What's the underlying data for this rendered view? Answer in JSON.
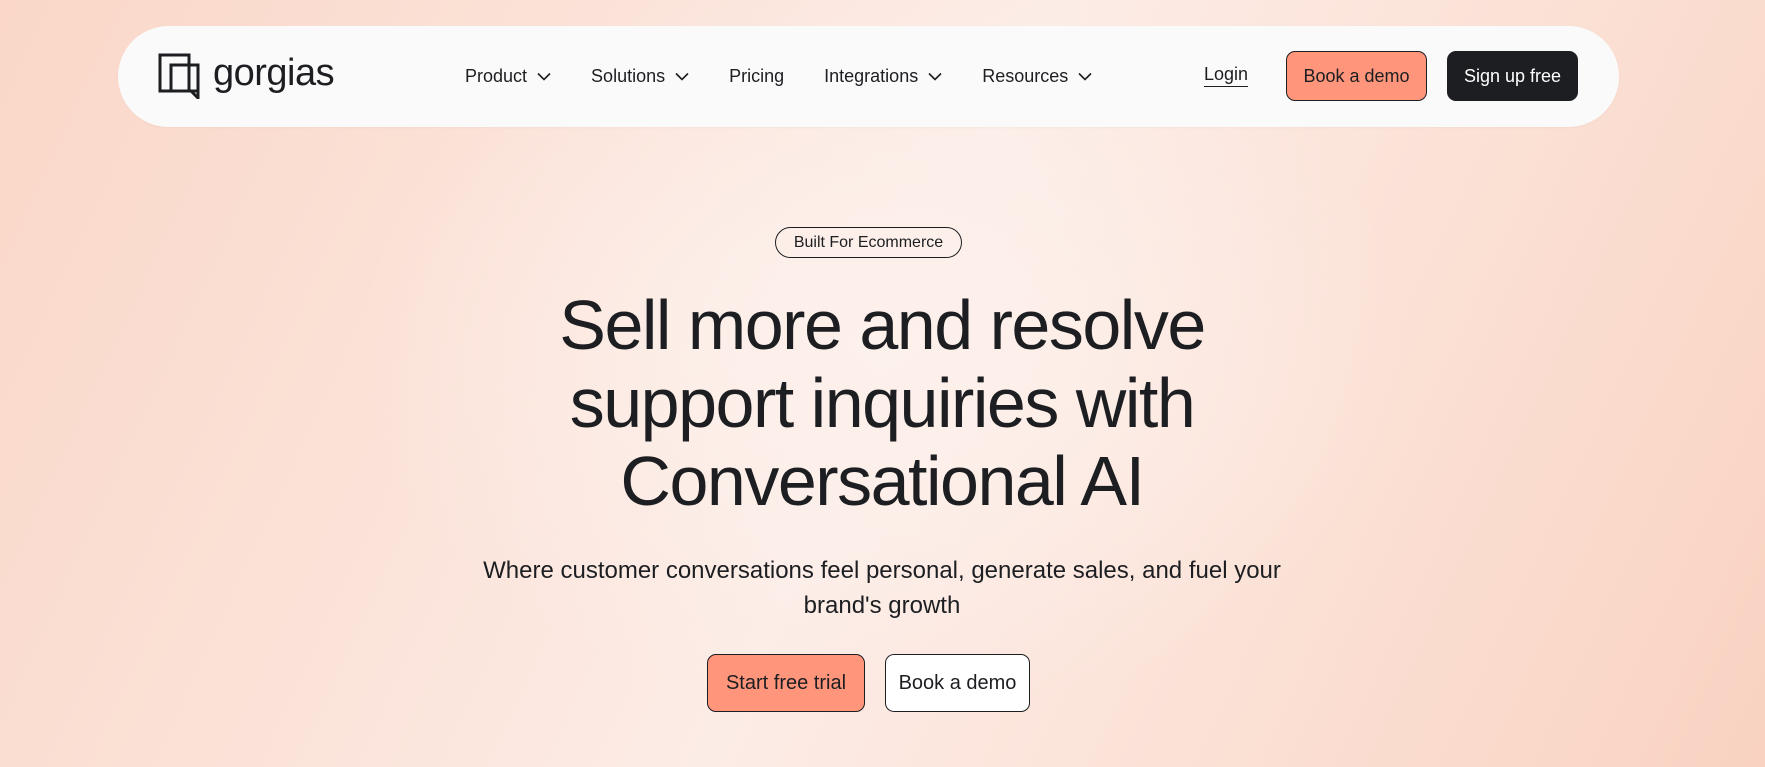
{
  "brand": {
    "name": "gorgias",
    "logo_icon": "gorgias-logo-mark",
    "primary_color": "#ff967c",
    "dark_color": "#1c1e21"
  },
  "nav": {
    "items": [
      {
        "label": "Product",
        "has_dropdown": true,
        "icon": "chevron-down-icon"
      },
      {
        "label": "Solutions",
        "has_dropdown": true,
        "icon": "chevron-down-icon"
      },
      {
        "label": "Pricing",
        "has_dropdown": false
      },
      {
        "label": "Integrations",
        "has_dropdown": true,
        "icon": "chevron-down-icon"
      },
      {
        "label": "Resources",
        "has_dropdown": true,
        "icon": "chevron-down-icon"
      }
    ],
    "login_label": "Login",
    "book_demo_label": "Book a demo",
    "signup_label": "Sign up free"
  },
  "hero": {
    "badge": "Built For Ecommerce",
    "title_lines": [
      "Sell more and resolve",
      "support inquiries with",
      "Conversational AI"
    ],
    "subtitle_lines": [
      "Where customer conversations feel personal, generate sales, and fuel your",
      "brand's growth"
    ],
    "primary_cta": "Start free trial",
    "secondary_cta": "Book a demo"
  }
}
